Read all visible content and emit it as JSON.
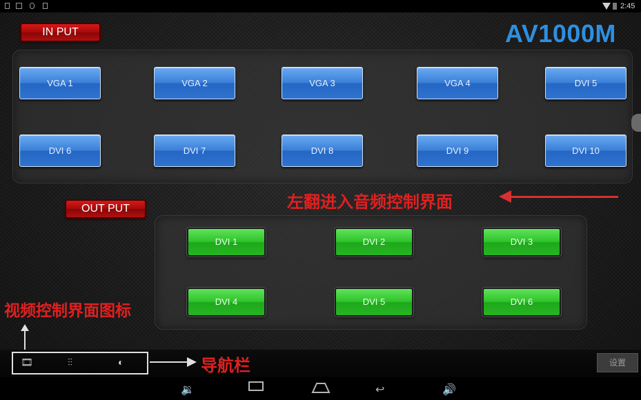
{
  "status_bar": {
    "time": "2:45"
  },
  "header": {
    "input_label": "IN PUT",
    "app_title": "AV1000M"
  },
  "inputs": [
    {
      "label": "VGA 1"
    },
    {
      "label": "VGA 2"
    },
    {
      "label": "VGA 3"
    },
    {
      "label": "VGA 4"
    },
    {
      "label": "DVI 5"
    },
    {
      "label": "DVI 6"
    },
    {
      "label": "DVI 7"
    },
    {
      "label": "DVI 8"
    },
    {
      "label": "DVI 9"
    },
    {
      "label": "DVI 10"
    }
  ],
  "output_section": {
    "label": "OUT PUT"
  },
  "outputs": [
    {
      "label": "DVI 1"
    },
    {
      "label": "DVI 2"
    },
    {
      "label": "DVI 3"
    },
    {
      "label": "DVI 4"
    },
    {
      "label": "DVI 5"
    },
    {
      "label": "DVI 6"
    }
  ],
  "annotations": {
    "swipe_left": "左翻进入音频控制界面",
    "video_icon": "视频控制界面图标",
    "nav_bar": "导航栏"
  },
  "nav": {
    "icons": [
      "video-control-icon",
      "audio-mixer-icon",
      "globe-icon"
    ],
    "settings_label": "设置"
  },
  "system_bar": {
    "icons": [
      "volume-down-icon",
      "recent-apps-icon",
      "home-icon",
      "back-icon",
      "volume-up-icon"
    ]
  },
  "colors": {
    "title_blue": "#2f8fe0",
    "input_tile": "#3b80d9",
    "output_tile": "#2fc42b",
    "section_red": "#c01010",
    "annotation_red": "#e02020"
  }
}
